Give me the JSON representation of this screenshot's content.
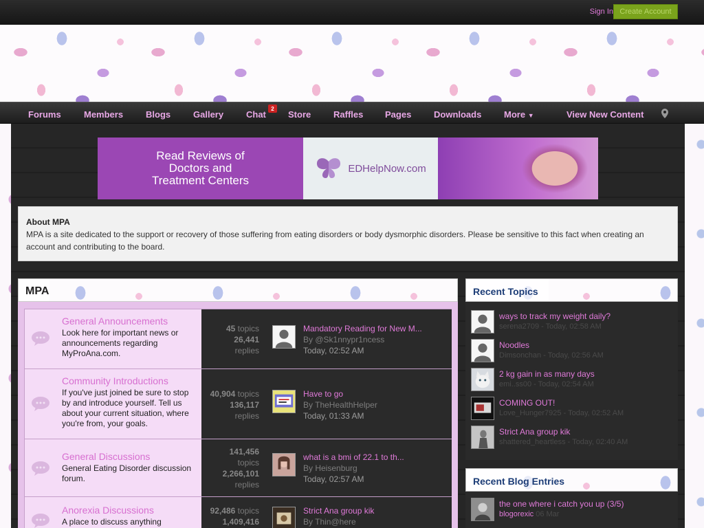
{
  "topbar": {
    "sign_in": "Sign In",
    "create_account": "Create Account"
  },
  "nav": {
    "items": [
      {
        "label": "Forums"
      },
      {
        "label": "Members"
      },
      {
        "label": "Blogs"
      },
      {
        "label": "Gallery"
      },
      {
        "label": "Chat"
      },
      {
        "label": "Store"
      },
      {
        "label": "Raffles"
      },
      {
        "label": "Pages"
      },
      {
        "label": "Downloads"
      },
      {
        "label": "More"
      },
      {
        "label": "View New Content"
      }
    ],
    "chat_badge": "2"
  },
  "ad": {
    "line1": "Read Reviews of",
    "line2": "Doctors and",
    "line3": "Treatment Centers",
    "brand": "EDHelpNow.com"
  },
  "about": {
    "title": "About MPA",
    "text": "MPA is a site dedicated to the support or recovery of those suffering from eating disorders or body dysmorphic disorders. Please be sensitive to this fact when creating an account and contributing to the board."
  },
  "forum": {
    "header": "MPA",
    "rows": [
      {
        "title": "General Announcements",
        "desc": "Look here for important news or announcements regarding MyProAna.com.",
        "topics_n": "45",
        "topics_l": "topics",
        "replies_n": "26,441",
        "replies_l": "replies",
        "lp_title": "Mandatory Reading for New M...",
        "lp_by": "By @Sk1nnypr1ncess",
        "lp_time": "Today, 02:52 AM"
      },
      {
        "title": "Community Introductions",
        "desc": "If you've just joined be sure to stop by and introduce yourself. Tell us about your current situation, where you're from, your goals.",
        "topics_n": "40,904",
        "topics_l": "topics",
        "replies_n": "136,117",
        "replies_l": "replies",
        "lp_title": "Have to go",
        "lp_by": "By TheHealthHelper",
        "lp_time": "Today, 01:33 AM"
      },
      {
        "title": "General Discussions",
        "desc": "General Eating Disorder discussion forum.",
        "topics_n": "141,456",
        "topics_l": "topics",
        "replies_n": "2,266,101",
        "replies_l": "replies",
        "lp_title": "what is a bmi of 22.1 to th...",
        "lp_by": "By Heisenburg",
        "lp_time": "Today, 02:57 AM"
      },
      {
        "title": "Anorexia Discussions",
        "desc": "A place to discuss anything",
        "topics_n": "92,486",
        "topics_l": "topics",
        "replies_n": "1,409,416",
        "replies_l": "",
        "lp_title": "Strict Ana group kik",
        "lp_by": "By Thin@here",
        "lp_time": ""
      }
    ]
  },
  "recent_topics": {
    "header": "Recent Topics",
    "items": [
      {
        "title": "ways to track my weight daily?",
        "meta": "serena2709 - Today, 02:58 AM"
      },
      {
        "title": "Noodles",
        "meta": "Dimsonchan - Today, 02:56 AM"
      },
      {
        "title": "2 kg gain in as many days",
        "meta": "emi..ss00 - Today, 02:54 AM"
      },
      {
        "title": "COMING OUT!",
        "meta": "Love_Hunger7925 - Today, 02:52 AM"
      },
      {
        "title": "Strict Ana group kik",
        "meta": "shattered_heartless - Today, 02:40 AM"
      }
    ]
  },
  "recent_blogs": {
    "header": "Recent Blog Entries",
    "items": [
      {
        "title": "the one where i catch you up (3/5)",
        "author": "blogorexic",
        "date": "06 Mar"
      }
    ]
  },
  "colors": {
    "accent": "#e07ad9",
    "nav_text": "#e8a8e6",
    "create_btn": "#7aa31c",
    "sidebar_header": "#1d3d77"
  }
}
